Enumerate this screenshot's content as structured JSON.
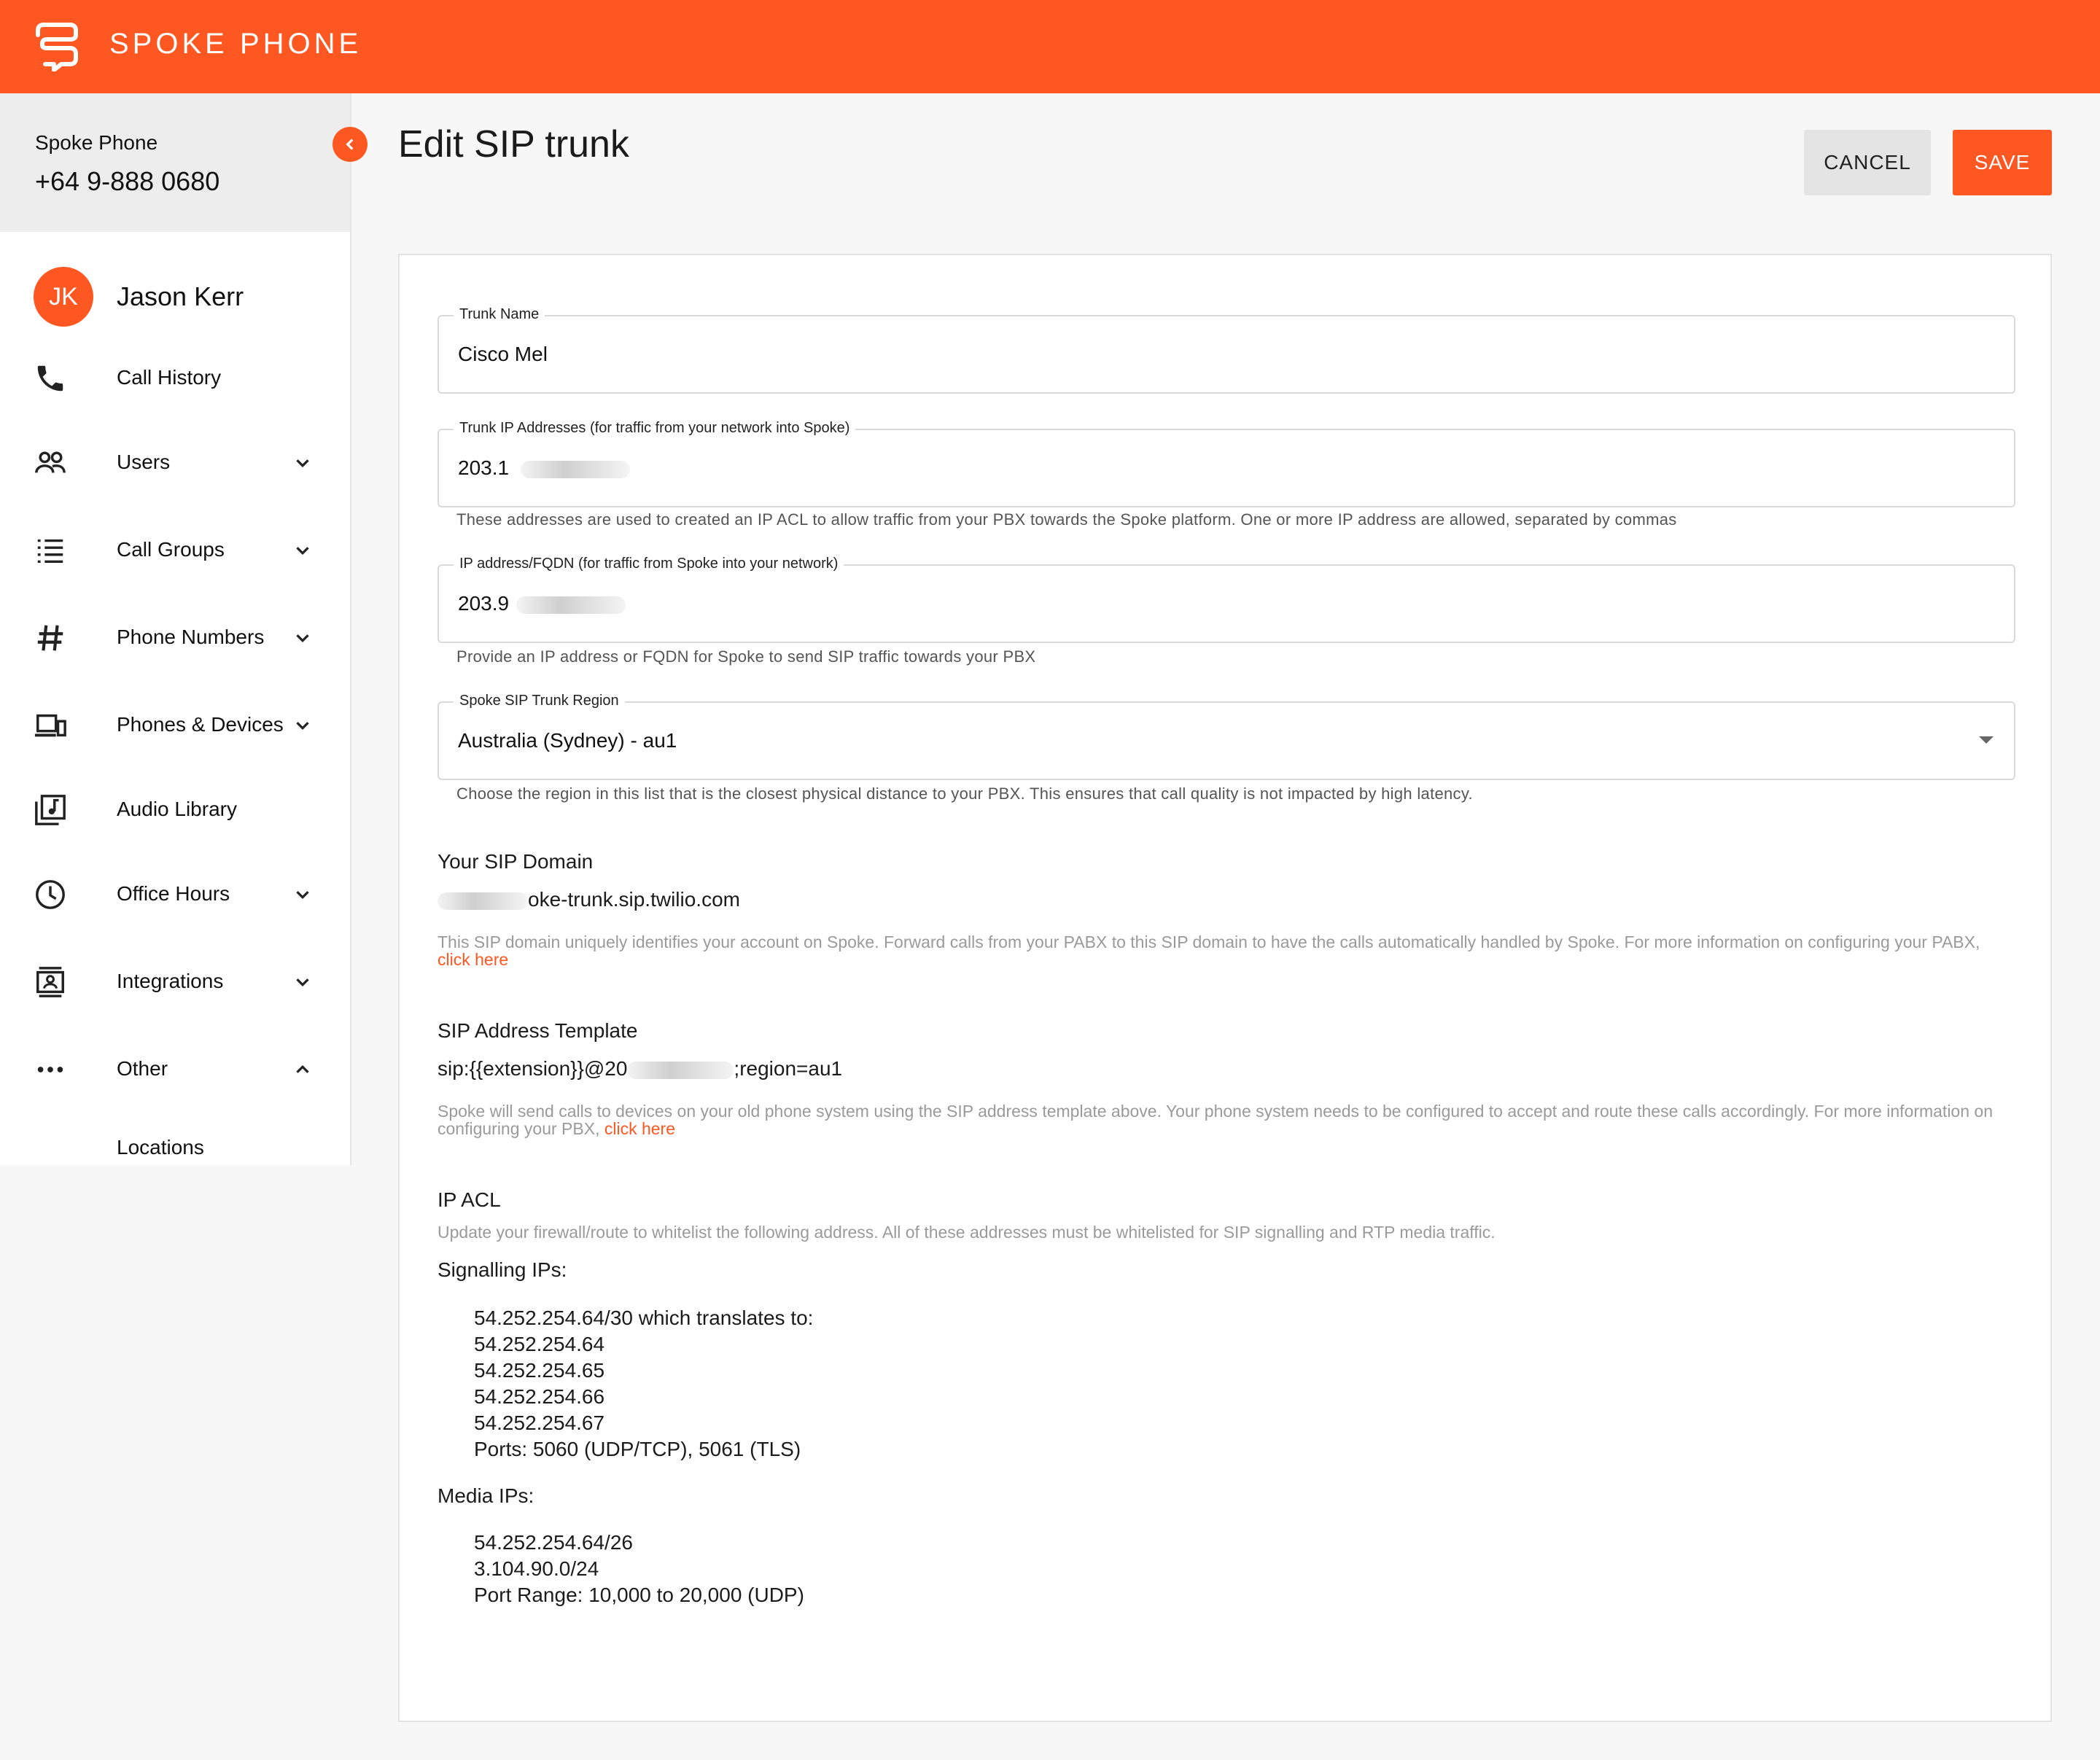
{
  "app": {
    "brand": "SPOKE PHONE",
    "brand_color": "#ff5722"
  },
  "sidebar": {
    "company_name": "Spoke Phone",
    "company_phone": "+64 9-888 0680",
    "user": {
      "initials": "JK",
      "name": "Jason Kerr"
    },
    "items": [
      {
        "label": "Call History",
        "icon": "phone-icon",
        "expandable": false
      },
      {
        "label": "Users",
        "icon": "users-icon",
        "expandable": true,
        "expanded": false
      },
      {
        "label": "Call Groups",
        "icon": "list-icon",
        "expandable": true,
        "expanded": false
      },
      {
        "label": "Phone Numbers",
        "icon": "hash-icon",
        "expandable": true,
        "expanded": false
      },
      {
        "label": "Phones & Devices",
        "icon": "devices-icon",
        "expandable": true,
        "expanded": false
      },
      {
        "label": "Audio Library",
        "icon": "music-library-icon",
        "expandable": false
      },
      {
        "label": "Office Hours",
        "icon": "clock-icon",
        "expandable": true,
        "expanded": false
      },
      {
        "label": "Integrations",
        "icon": "contact-card-icon",
        "expandable": true,
        "expanded": false
      },
      {
        "label": "Other",
        "icon": "more-horiz-icon",
        "expandable": true,
        "expanded": true
      }
    ],
    "sub_items": [
      {
        "label": "Locations"
      }
    ]
  },
  "header": {
    "title": "Edit SIP trunk",
    "cancel_label": "CANCEL",
    "save_label": "SAVE"
  },
  "form": {
    "trunk_name": {
      "label": "Trunk Name",
      "value": "Cisco Mel"
    },
    "trunk_ips": {
      "label": "Trunk IP Addresses (for traffic from your network into Spoke)",
      "value_visible": "203.1",
      "helper": "These addresses are used to created an IP ACL to allow traffic from your PBX towards the Spoke platform. One or more IP address are allowed, separated by commas"
    },
    "fqdn": {
      "label": "IP address/FQDN (for traffic from Spoke into your network)",
      "value_visible": "203.9",
      "helper": "Provide an IP address or FQDN for Spoke to send SIP traffic towards your PBX"
    },
    "region": {
      "label": "Spoke SIP Trunk Region",
      "value": "Australia (Sydney) - au1",
      "helper": "Choose the region in this list that is the closest physical distance to your PBX. This ensures that call quality is not impacted by high latency."
    }
  },
  "sip_domain": {
    "title": "Your SIP Domain",
    "value_visible": "oke-trunk.sip.twilio.com",
    "desc": "This SIP domain uniquely identifies your account on Spoke. Forward calls from your PABX to this SIP domain to have the calls automatically handled by Spoke. For more information on configuring your PABX,",
    "link": "click here"
  },
  "sip_template": {
    "title": "SIP Address Template",
    "value_prefix": "sip:{{extension}}@20",
    "value_suffix": ";region=au1",
    "desc": "Spoke will send calls to devices on your old phone system using the SIP address template above. Your phone system needs to be configured to accept and route these calls accordingly. For more information on configuring your PBX,",
    "link": "click here"
  },
  "ip_acl": {
    "title": "IP ACL",
    "desc": "Update your firewall/route to whitelist the following address. All of these addresses must be whitelisted for SIP signalling and RTP media traffic.",
    "signalling_title": "Signalling IPs:",
    "signalling": [
      "54.252.254.64/30 which translates to:",
      "54.252.254.64",
      "54.252.254.65",
      "54.252.254.66",
      "54.252.254.67",
      "Ports: 5060 (UDP/TCP), 5061 (TLS)"
    ],
    "media_title": "Media IPs:",
    "media": [
      "54.252.254.64/26",
      "3.104.90.0/24",
      "Port Range: 10,000 to 20,000 (UDP)"
    ]
  }
}
